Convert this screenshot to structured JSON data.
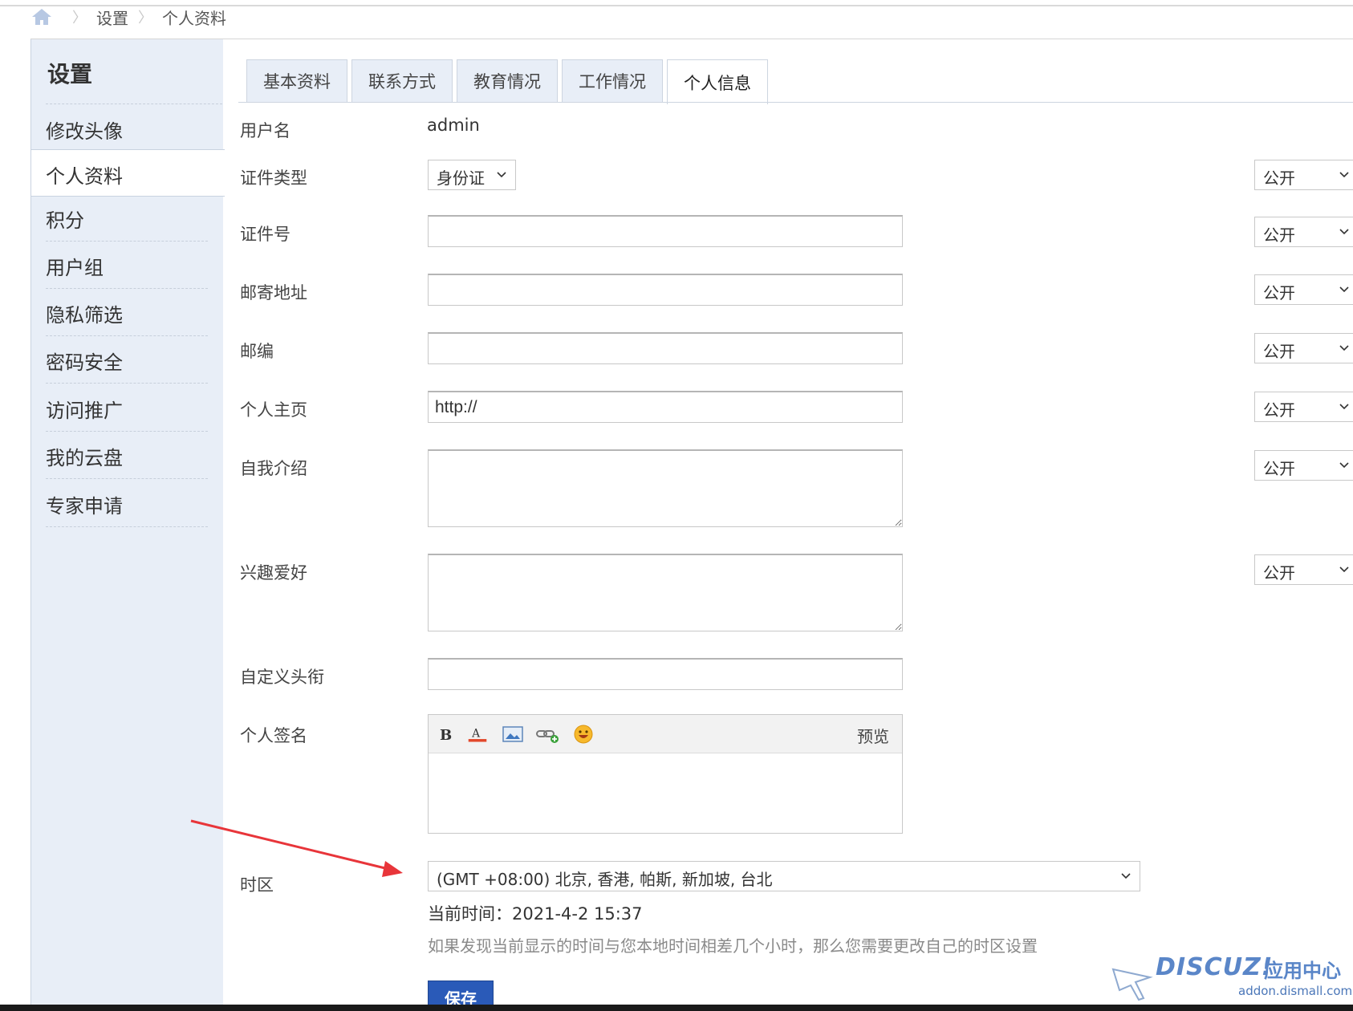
{
  "breadcrumb": {
    "items": [
      "设置",
      "个人资料"
    ]
  },
  "sidebar": {
    "title": "设置",
    "items": [
      {
        "label": "修改头像",
        "active": false
      },
      {
        "label": "个人资料",
        "active": true
      },
      {
        "label": "积分",
        "active": false
      },
      {
        "label": "用户组",
        "active": false
      },
      {
        "label": "隐私筛选",
        "active": false
      },
      {
        "label": "密码安全",
        "active": false
      },
      {
        "label": "访问推广",
        "active": false
      },
      {
        "label": "我的云盘",
        "active": false
      },
      {
        "label": "专家申请",
        "active": false
      }
    ]
  },
  "tabs": [
    {
      "label": "基本资料",
      "active": false
    },
    {
      "label": "联系方式",
      "active": false
    },
    {
      "label": "教育情况",
      "active": false
    },
    {
      "label": "工作情况",
      "active": false
    },
    {
      "label": "个人信息",
      "active": true
    }
  ],
  "form": {
    "username": {
      "label": "用户名",
      "value": "admin"
    },
    "id_type": {
      "label": "证件类型",
      "value": "身份证",
      "privacy": "公开"
    },
    "id_number": {
      "label": "证件号",
      "value": "",
      "privacy": "公开"
    },
    "address": {
      "label": "邮寄地址",
      "value": "",
      "privacy": "公开"
    },
    "zipcode": {
      "label": "邮编",
      "value": "",
      "privacy": "公开"
    },
    "homepage": {
      "label": "个人主页",
      "value": "http://",
      "privacy": "公开"
    },
    "bio": {
      "label": "自我介绍",
      "value": "",
      "privacy": "公开"
    },
    "interests": {
      "label": "兴趣爱好",
      "value": "",
      "privacy": "公开"
    },
    "custom_title": {
      "label": "自定义头衔",
      "value": ""
    },
    "signature": {
      "label": "个人签名",
      "preview_label": "预览",
      "tools": [
        "bold-icon",
        "font-color-icon",
        "image-icon",
        "link-icon",
        "smiley-icon"
      ]
    },
    "timezone": {
      "label": "时区",
      "value": "(GMT +08:00) 北京, 香港, 帕斯, 新加坡, 台北"
    },
    "current_time": "当前时间：2021-4-2 15:37",
    "hint": "如果发现当前显示的时间与您本地时间相差几个小时，那么您需要更改自己的时区设置",
    "save_label": "保存"
  },
  "watermark": {
    "brand": "DISCUZ!",
    "text": "应用中心",
    "url": "addon.dismall.com"
  },
  "colors": {
    "sidebar_bg": "#e8eef7",
    "save_button": "#2a5ab8",
    "arrow": "#e8353a",
    "watermark": "#5a86c8"
  }
}
